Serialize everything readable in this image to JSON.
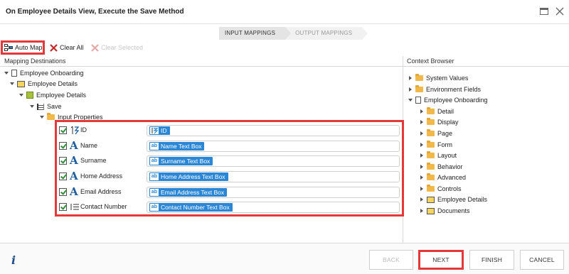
{
  "window": {
    "title": "On Employee Details View, Execute the Save Method"
  },
  "wizard": {
    "steps": [
      {
        "label": "INPUT MAPPINGS",
        "active": true
      },
      {
        "label": "OUTPUT MAPPINGS",
        "active": false
      }
    ]
  },
  "toolbar": {
    "auto_map": "Auto Map",
    "clear_all": "Clear All",
    "clear_selected": "Clear Selected"
  },
  "mapping_destinations": {
    "header": "Mapping Destinations",
    "tree": [
      {
        "label": "Employee Onboarding",
        "icon": "document-icon"
      },
      {
        "label": "Employee Details",
        "icon": "view-icon"
      },
      {
        "label": "Employee Details",
        "icon": "smartobject-icon"
      },
      {
        "label": "Save",
        "icon": "method-icon"
      },
      {
        "label": "Input Properties",
        "icon": "folder-icon"
      }
    ],
    "properties": [
      {
        "label": "ID",
        "icon": "autonumber-icon",
        "value": "ID",
        "value_icon": "autonumber-icon"
      },
      {
        "label": "Name",
        "icon": "text-icon",
        "value": "Name Text Box",
        "value_icon": "textbox-icon"
      },
      {
        "label": "Surname",
        "icon": "text-icon",
        "value": "Surname Text Box",
        "value_icon": "textbox-icon"
      },
      {
        "label": "Home Address",
        "icon": "text-icon",
        "value": "Home Address Text Box",
        "value_icon": "textbox-icon"
      },
      {
        "label": "Email Address",
        "icon": "text-icon",
        "value": "Email Address Text Box",
        "value_icon": "textbox-icon"
      },
      {
        "label": "Contact Number",
        "icon": "number-icon",
        "value": "Contact Number Text Box",
        "value_icon": "textbox-icon"
      }
    ]
  },
  "context_browser": {
    "header": "Context Browser",
    "items": [
      {
        "label": "System Values"
      },
      {
        "label": "Environment Fields"
      },
      {
        "label": "Employee Onboarding"
      },
      {
        "label": "Detail"
      },
      {
        "label": "Display"
      },
      {
        "label": "Page"
      },
      {
        "label": "Form"
      },
      {
        "label": "Layout"
      },
      {
        "label": "Behavior"
      },
      {
        "label": "Advanced"
      },
      {
        "label": "Controls"
      },
      {
        "label": "Employee Details"
      },
      {
        "label": "Documents"
      }
    ]
  },
  "footer": {
    "info": "i",
    "back": "BACK",
    "next": "NEXT",
    "finish": "FINISH",
    "cancel": "CANCEL"
  },
  "colors": {
    "highlight": "#e5383b",
    "chip": "#2b87d6",
    "folder": "#f2b94a"
  }
}
